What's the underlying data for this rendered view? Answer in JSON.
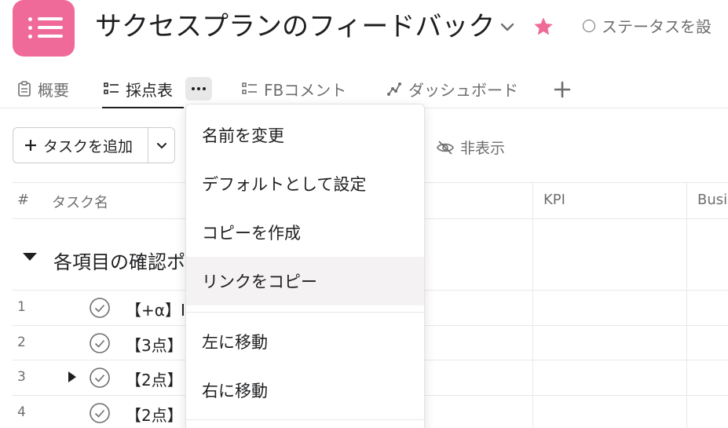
{
  "app": {
    "icon": "list-icon",
    "icon_color": "#f06a99",
    "title": "サクセスプランのフィードバック",
    "status_label": "ステータスを設",
    "favorite_color": "#f06a99"
  },
  "tabs": [
    {
      "label": "概要",
      "icon": "clipboard-icon",
      "active": false
    },
    {
      "label": "採点表",
      "icon": "list-icon",
      "active": true
    },
    {
      "label": "FBコメント",
      "icon": "list-icon",
      "active": false
    },
    {
      "label": "ダッシュボード",
      "icon": "graph-icon",
      "active": false
    }
  ],
  "toolbar": {
    "add_task_label": "タスクを追加",
    "hide_label": "非表示"
  },
  "table": {
    "columns": [
      "#",
      "タスク名",
      "KPI",
      "Busi"
    ],
    "section_title": "各項目の確認ポ",
    "rows": [
      {
        "num": "1",
        "name": "【+α】I",
        "expandable": false
      },
      {
        "num": "2",
        "name": "【3点】",
        "expandable": false
      },
      {
        "num": "3",
        "name": "【2点】",
        "expandable": true
      },
      {
        "num": "4",
        "name": "【2点】",
        "expandable": false
      }
    ]
  },
  "menu": {
    "items": [
      {
        "label": "名前を変更"
      },
      {
        "label": "デフォルトとして設定"
      },
      {
        "label": "コピーを作成"
      },
      {
        "label": "リンクをコピー",
        "hovered": true
      },
      {
        "label": "左に移動"
      },
      {
        "label": "右に移動"
      }
    ]
  }
}
